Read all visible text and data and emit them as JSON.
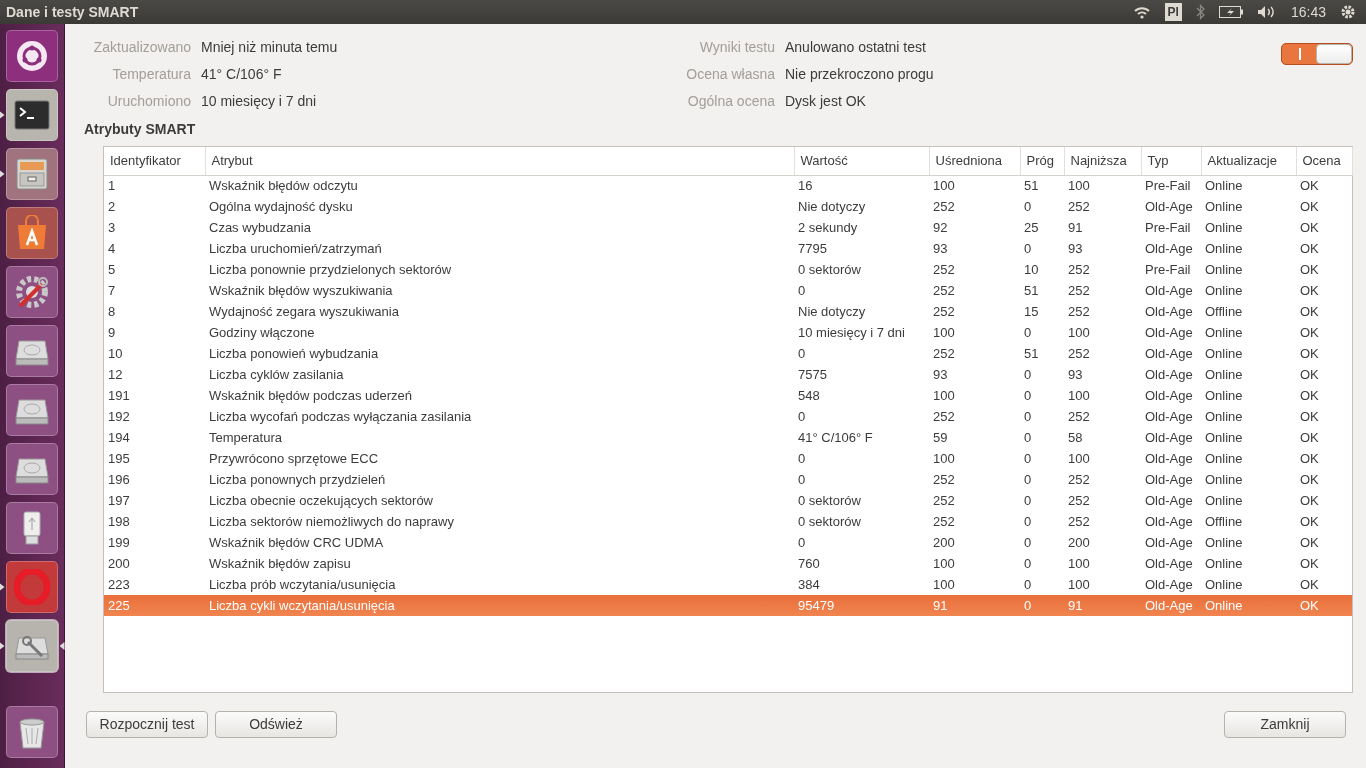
{
  "window": {
    "title": "Dane i testy SMART"
  },
  "top_bar": {
    "keyboard_layout": "Pl",
    "clock": "16:43"
  },
  "launcher": [
    {
      "kind": "dash",
      "running": false,
      "focused": false
    },
    {
      "kind": "terminal",
      "running": true,
      "focused": false
    },
    {
      "kind": "files",
      "running": true,
      "focused": false
    },
    {
      "kind": "store",
      "running": false,
      "focused": false
    },
    {
      "kind": "settings",
      "running": false,
      "focused": false
    },
    {
      "kind": "drive",
      "running": false,
      "focused": false
    },
    {
      "kind": "drive",
      "running": false,
      "focused": false
    },
    {
      "kind": "drive",
      "running": false,
      "focused": false
    },
    {
      "kind": "usb",
      "running": false,
      "focused": false
    },
    {
      "kind": "browser",
      "running": true,
      "focused": false
    },
    {
      "kind": "disks",
      "running": true,
      "focused": true
    },
    {
      "kind": "trash",
      "running": false,
      "focused": false
    }
  ],
  "info_left": [
    {
      "label": "Zaktualizowano",
      "value": "Mniej niż minuta temu"
    },
    {
      "label": "Temperatura",
      "value": "41° C/106° F"
    },
    {
      "label": "Uruchomiono",
      "value": "10 miesięcy i 7 dni"
    }
  ],
  "info_right": [
    {
      "label": "Wyniki testu",
      "value": "Anulowano ostatni test"
    },
    {
      "label": "Ocena własna",
      "value": "Nie przekroczono progu"
    },
    {
      "label": "Ogólna ocena",
      "value": "Dysk jest OK"
    }
  ],
  "smart_switch": {
    "on": true
  },
  "section_title": "Atrybuty SMART",
  "table": {
    "columns": [
      "Identyfikator",
      "Atrybut",
      "Wartość",
      "Uśredniona",
      "Próg",
      "Najniższa",
      "Typ",
      "Aktualizacje",
      "Ocena"
    ],
    "rows": [
      {
        "selected": false,
        "cells": [
          "1",
          "Wskaźnik błędów odczytu",
          "16",
          "100",
          "51",
          "100",
          "Pre-Fail",
          "Online",
          "OK"
        ]
      },
      {
        "selected": false,
        "cells": [
          "2",
          "Ogólna wydajność dysku",
          "Nie dotyczy",
          "252",
          "0",
          "252",
          "Old-Age",
          "Online",
          "OK"
        ]
      },
      {
        "selected": false,
        "cells": [
          "3",
          "Czas wybudzania",
          "2 sekundy",
          "92",
          "25",
          "91",
          "Pre-Fail",
          "Online",
          "OK"
        ]
      },
      {
        "selected": false,
        "cells": [
          "4",
          "Liczba uruchomień/zatrzymań",
          "7795",
          "93",
          "0",
          "93",
          "Old-Age",
          "Online",
          "OK"
        ]
      },
      {
        "selected": false,
        "cells": [
          "5",
          "Liczba ponownie przydzielonych sektorów",
          "0 sektorów",
          "252",
          "10",
          "252",
          "Pre-Fail",
          "Online",
          "OK"
        ]
      },
      {
        "selected": false,
        "cells": [
          "7",
          "Wskaźnik błędów wyszukiwania",
          "0",
          "252",
          "51",
          "252",
          "Old-Age",
          "Online",
          "OK"
        ]
      },
      {
        "selected": false,
        "cells": [
          "8",
          "Wydajność zegara wyszukiwania",
          "Nie dotyczy",
          "252",
          "15",
          "252",
          "Old-Age",
          "Offline",
          "OK"
        ]
      },
      {
        "selected": false,
        "cells": [
          "9",
          "Godziny włączone",
          "10 miesięcy i 7 dni",
          "100",
          "0",
          "100",
          "Old-Age",
          "Online",
          "OK"
        ]
      },
      {
        "selected": false,
        "cells": [
          "10",
          "Liczba ponowień wybudzania",
          "0",
          "252",
          "51",
          "252",
          "Old-Age",
          "Online",
          "OK"
        ]
      },
      {
        "selected": false,
        "cells": [
          "12",
          "Liczba cyklów zasilania",
          "7575",
          "93",
          "0",
          "93",
          "Old-Age",
          "Online",
          "OK"
        ]
      },
      {
        "selected": false,
        "cells": [
          "191",
          "Wskaźnik błędów podczas uderzeń",
          "548",
          "100",
          "0",
          "100",
          "Old-Age",
          "Online",
          "OK"
        ]
      },
      {
        "selected": false,
        "cells": [
          "192",
          "Liczba wycofań podczas wyłączania zasilania",
          "0",
          "252",
          "0",
          "252",
          "Old-Age",
          "Online",
          "OK"
        ]
      },
      {
        "selected": false,
        "cells": [
          "194",
          "Temperatura",
          "41° C/106° F",
          "59",
          "0",
          "58",
          "Old-Age",
          "Online",
          "OK"
        ]
      },
      {
        "selected": false,
        "cells": [
          "195",
          "Przywrócono sprzętowe ECC",
          "0",
          "100",
          "0",
          "100",
          "Old-Age",
          "Online",
          "OK"
        ]
      },
      {
        "selected": false,
        "cells": [
          "196",
          "Liczba ponownych przydzieleń",
          "0",
          "252",
          "0",
          "252",
          "Old-Age",
          "Online",
          "OK"
        ]
      },
      {
        "selected": false,
        "cells": [
          "197",
          "Liczba obecnie oczekujących sektorów",
          "0 sektorów",
          "252",
          "0",
          "252",
          "Old-Age",
          "Online",
          "OK"
        ]
      },
      {
        "selected": false,
        "cells": [
          "198",
          "Liczba sektorów niemożliwych do naprawy",
          "0 sektorów",
          "252",
          "0",
          "252",
          "Old-Age",
          "Offline",
          "OK"
        ]
      },
      {
        "selected": false,
        "cells": [
          "199",
          "Wskaźnik błędów CRC UDMA",
          "0",
          "200",
          "0",
          "200",
          "Old-Age",
          "Online",
          "OK"
        ]
      },
      {
        "selected": false,
        "cells": [
          "200",
          "Wskaźnik błędów zapisu",
          "760",
          "100",
          "0",
          "100",
          "Old-Age",
          "Online",
          "OK"
        ]
      },
      {
        "selected": false,
        "cells": [
          "223",
          "Liczba prób wczytania/usunięcia",
          "384",
          "100",
          "0",
          "100",
          "Old-Age",
          "Online",
          "OK"
        ]
      },
      {
        "selected": true,
        "cells": [
          "225",
          "Liczba cykli wczytania/usunięcia",
          "95479",
          "91",
          "0",
          "91",
          "Old-Age",
          "Online",
          "OK"
        ]
      }
    ]
  },
  "buttons_left": [
    "Rozpocznij test",
    "Odśwież"
  ],
  "buttons_right": [
    "Zamknij"
  ]
}
